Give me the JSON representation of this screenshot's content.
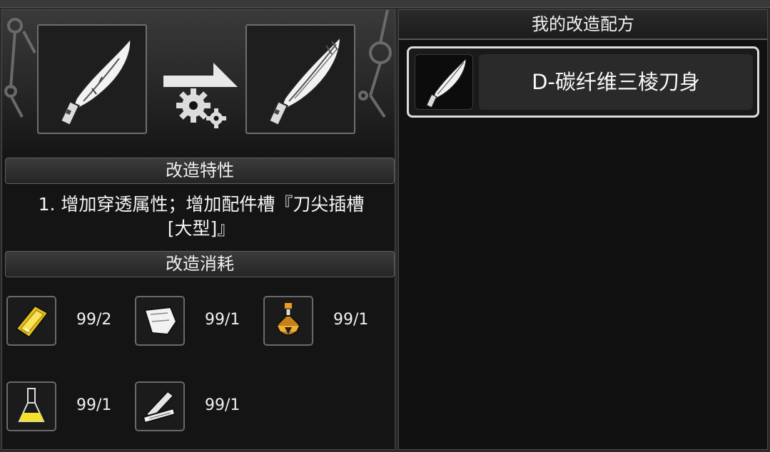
{
  "window": {
    "right_title": "我的改造配方"
  },
  "modify": {
    "source_item_icon": "curved-blade-icon",
    "result_item_icon": "carbon-fiber-blade-icon",
    "arrow_icon": "arrow-right-icon",
    "process_icon": "gears-icon"
  },
  "traits": {
    "header": "改造特性",
    "line1": "1. 增加穿透属性；增加配件槽『刀尖插槽",
    "line2": "[大型]』"
  },
  "cost": {
    "header": "改造消耗",
    "items": [
      {
        "icon": "gold-plate-icon",
        "count": "99/2"
      },
      {
        "icon": "cloth-scrap-icon",
        "count": "99/1"
      },
      {
        "icon": "amber-potion-icon",
        "count": "99/1"
      },
      {
        "icon": "yellow-flask-icon",
        "count": "99/1"
      },
      {
        "icon": "wood-planks-icon",
        "count": "99/1"
      }
    ]
  },
  "recipes": [
    {
      "icon": "carbon-fiber-blade-icon",
      "name": "D-碳纤维三棱刀身"
    }
  ]
}
